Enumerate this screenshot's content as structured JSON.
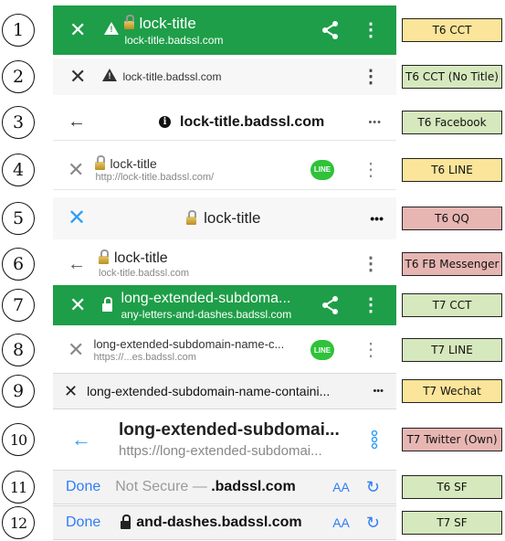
{
  "rows": [
    {
      "number": "1",
      "title": "lock-title",
      "url": "lock-title.badssl.com",
      "tag": "T6 CCT"
    },
    {
      "number": "2",
      "url": "lock-title.badssl.com",
      "tag": "T6 CCT (No Title)"
    },
    {
      "number": "3",
      "url": "lock-title.badssl.com",
      "more": "•••",
      "tag": "T6 Facebook"
    },
    {
      "number": "4",
      "title": "lock-title",
      "url": "http://lock-title.badssl.com/",
      "badge": "LINE",
      "tag": "T6 LINE"
    },
    {
      "number": "5",
      "title": "lock-title",
      "more": "•••",
      "tag": "T6 QQ"
    },
    {
      "number": "6",
      "title": "lock-title",
      "url": "lock-title.badssl.com",
      "tag": "T6 FB Messenger"
    },
    {
      "number": "7",
      "title": "long-extended-subdoma...",
      "url": "any-letters-and-dashes.badssl.com",
      "tag": "T7 CCT"
    },
    {
      "number": "8",
      "title": "long-extended-subdomain-name-c...",
      "url": "https://...es.badssl.com",
      "badge": "LINE",
      "tag": "T7 LINE"
    },
    {
      "number": "9",
      "title": "long-extended-subdomain-name-containi...",
      "more": "•••",
      "tag": "T7 Wechat"
    },
    {
      "number": "10",
      "title": "long-extended-subdomai...",
      "url": "https://long-extended-subdomai...",
      "tag": "T7 Twitter (Own)"
    },
    {
      "number": "11",
      "done": "Done",
      "prefix": "Not Secure — ",
      "fragment": ".badssl.com",
      "aa": "AA",
      "tag": "T6 SF"
    },
    {
      "number": "12",
      "done": "Done",
      "fragment": "and-dashes.badssl.com",
      "aa": "AA",
      "tag": "T7 SF"
    }
  ],
  "colors": {
    "cct_green": "#1e9e48",
    "line_green": "#2fc23a",
    "ios_blue": "#2f7cf6",
    "tag_yellow": "#fbe59a",
    "tag_green": "#d6e8bd",
    "tag_red": "#e7b6b3"
  },
  "icons": [
    "close-icon",
    "warning-icon",
    "lock-icon",
    "share-icon",
    "kebab-menu-icon",
    "back-arrow-icon",
    "info-icon",
    "more-dots-icon",
    "line-badge-icon",
    "reload-icon"
  ]
}
